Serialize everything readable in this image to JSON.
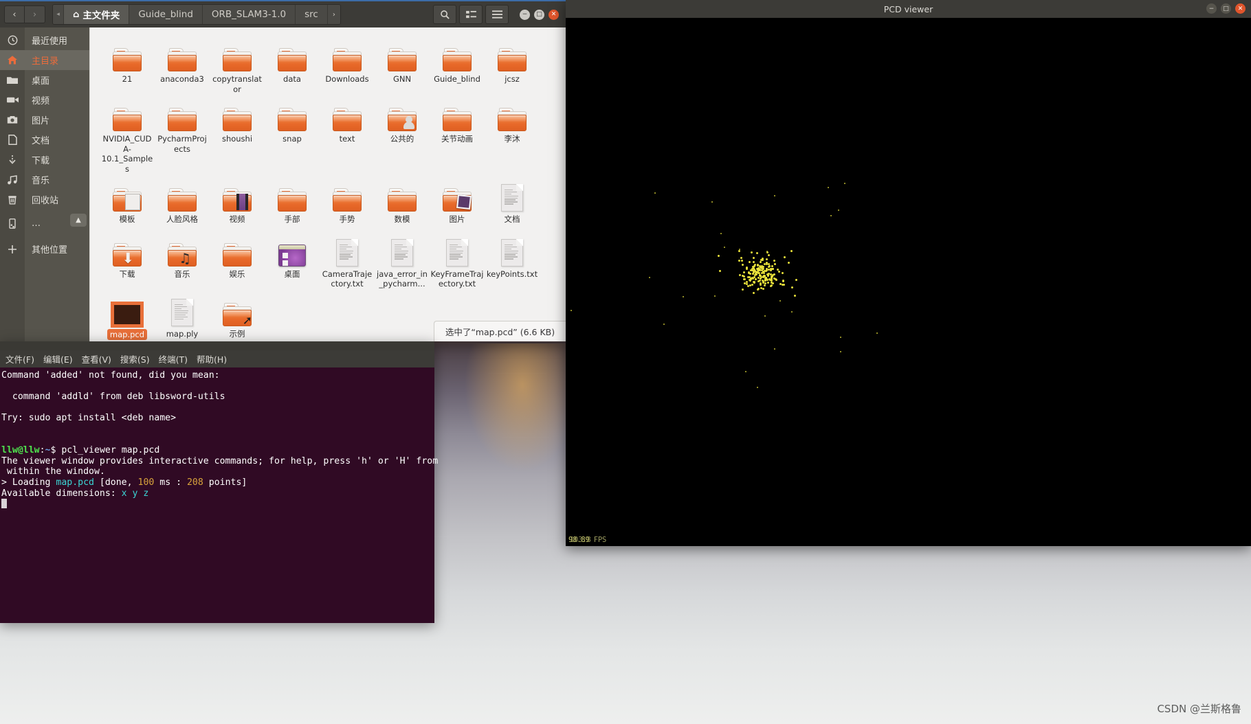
{
  "filemanager": {
    "nav": {
      "back": "‹",
      "forward": "›",
      "collapse": "◂"
    },
    "breadcrumbs": [
      {
        "label": "主文件夹",
        "icon": "home-icon",
        "active": true
      },
      {
        "label": "Guide_blind",
        "active": false
      },
      {
        "label": "ORB_SLAM3-1.0",
        "active": false
      },
      {
        "label": "src",
        "active": false
      }
    ],
    "path_next": "›",
    "toolbar": {
      "search": "search-icon",
      "viewgrid": "view-grid-icon",
      "menu": "hamburger-menu-icon"
    },
    "window_buttons": {
      "minimize": "−",
      "maximize": "□",
      "close": "✕"
    },
    "sidebar": [
      {
        "label": "最近使用",
        "icon": "clock-icon",
        "active": false
      },
      {
        "label": "主目录",
        "icon": "home-icon",
        "active": true
      },
      {
        "label": "桌面",
        "icon": "folder-icon",
        "active": false
      },
      {
        "label": "视频",
        "icon": "video-icon",
        "active": false
      },
      {
        "label": "图片",
        "icon": "camera-icon",
        "active": false
      },
      {
        "label": "文档",
        "icon": "document-icon",
        "active": false
      },
      {
        "label": "下载",
        "icon": "download-icon",
        "active": false
      },
      {
        "label": "音乐",
        "icon": "music-icon",
        "active": false
      },
      {
        "label": "回收站",
        "icon": "trash-icon",
        "active": false
      },
      {
        "label": "…",
        "icon": "device-icon",
        "active": false
      },
      {
        "label": "其他位置",
        "icon": "plus-icon",
        "active": false
      }
    ],
    "eject_icon": "eject-icon",
    "files": [
      {
        "name": "21",
        "type": "folder"
      },
      {
        "name": "anaconda3",
        "type": "folder"
      },
      {
        "name": "copytranslator",
        "type": "folder"
      },
      {
        "name": "data",
        "type": "folder"
      },
      {
        "name": "Downloads",
        "type": "folder"
      },
      {
        "name": "GNN",
        "type": "folder"
      },
      {
        "name": "Guide_blind",
        "type": "folder"
      },
      {
        "name": "jcsz",
        "type": "folder"
      },
      {
        "name": "NVIDIA_CUDA-10.1_Samples",
        "type": "folder"
      },
      {
        "name": "PycharmProjects",
        "type": "folder"
      },
      {
        "name": "shoushi",
        "type": "folder"
      },
      {
        "name": "snap",
        "type": "folder"
      },
      {
        "name": "text",
        "type": "folder"
      },
      {
        "name": "公共的",
        "type": "folder-public"
      },
      {
        "name": "关节动画",
        "type": "folder"
      },
      {
        "name": "李沐",
        "type": "folder"
      },
      {
        "name": "模板",
        "type": "folder-templates"
      },
      {
        "name": "人脸风格",
        "type": "folder"
      },
      {
        "name": "视频",
        "type": "folder-videos"
      },
      {
        "name": "手部",
        "type": "folder"
      },
      {
        "name": "手势",
        "type": "folder"
      },
      {
        "name": "数模",
        "type": "folder"
      },
      {
        "name": "图片",
        "type": "folder-pictures"
      },
      {
        "name": "文档",
        "type": "doc"
      },
      {
        "name": "下载",
        "type": "folder-downloads"
      },
      {
        "name": "音乐",
        "type": "folder-music"
      },
      {
        "name": "娱乐",
        "type": "folder"
      },
      {
        "name": "桌面",
        "type": "window"
      },
      {
        "name": "CameraTrajectory.txt",
        "type": "doc"
      },
      {
        "name": "java_error_in_pycharm...",
        "type": "doc"
      },
      {
        "name": "KeyFrameTrajectory.txt",
        "type": "doc"
      },
      {
        "name": "keyPoints.txt",
        "type": "doc"
      },
      {
        "name": "map.pcd",
        "type": "pcd",
        "selected": true
      },
      {
        "name": "map.ply",
        "type": "doc"
      },
      {
        "name": "示例",
        "type": "folder-link"
      }
    ],
    "status": "选中了“map.pcd” (6.6 KB)"
  },
  "pcdviewer": {
    "title": "PCD viewer",
    "window_buttons": {
      "minimize": "−",
      "maximize": "□",
      "close": "✕"
    },
    "fps_front": "98.89",
    "fps_back": "103.8",
    "fps_suffix": " FPS",
    "background": "#000000",
    "point_color": "#e8e03a",
    "point_count": 208
  },
  "terminal": {
    "menus": [
      "文件(F)",
      "编辑(E)",
      "查看(V)",
      "搜索(S)",
      "终端(T)",
      "帮助(H)"
    ],
    "lines": [
      {
        "segments": [
          {
            "t": "Command 'added' not found, did you mean:",
            "c": "plain"
          }
        ]
      },
      {
        "segments": [
          {
            "t": "",
            "c": "plain"
          }
        ]
      },
      {
        "segments": [
          {
            "t": "  command 'addld' from deb libsword-utils",
            "c": "plain"
          }
        ]
      },
      {
        "segments": [
          {
            "t": "",
            "c": "plain"
          }
        ]
      },
      {
        "segments": [
          {
            "t": "Try: sudo apt install <deb name>",
            "c": "plain"
          }
        ]
      },
      {
        "segments": [
          {
            "t": "",
            "c": "plain"
          }
        ]
      },
      {
        "segments": [
          {
            "t": "",
            "c": "plain"
          }
        ]
      },
      {
        "segments": [
          {
            "t": "llw@llw",
            "c": "user"
          },
          {
            "t": ":",
            "c": "plain"
          },
          {
            "t": "~",
            "c": "path"
          },
          {
            "t": "$ pcl_viewer map.pcd",
            "c": "plain"
          }
        ]
      },
      {
        "segments": [
          {
            "t": "The viewer window provides interactive commands; for help, press 'h' or 'H' from",
            "c": "plain"
          }
        ]
      },
      {
        "segments": [
          {
            "t": " within the window.",
            "c": "plain"
          }
        ]
      },
      {
        "segments": [
          {
            "t": "> Loading ",
            "c": "plain"
          },
          {
            "t": "map.pcd",
            "c": "cyan"
          },
          {
            "t": " [done, ",
            "c": "plain"
          },
          {
            "t": "100",
            "c": "orange"
          },
          {
            "t": " ms : ",
            "c": "plain"
          },
          {
            "t": "208",
            "c": "orange"
          },
          {
            "t": " points]",
            "c": "plain"
          }
        ]
      },
      {
        "segments": [
          {
            "t": "Available dimensions: ",
            "c": "plain"
          },
          {
            "t": "x y z",
            "c": "cyan"
          }
        ]
      }
    ]
  },
  "watermark": "CSDN @兰斯格鲁"
}
